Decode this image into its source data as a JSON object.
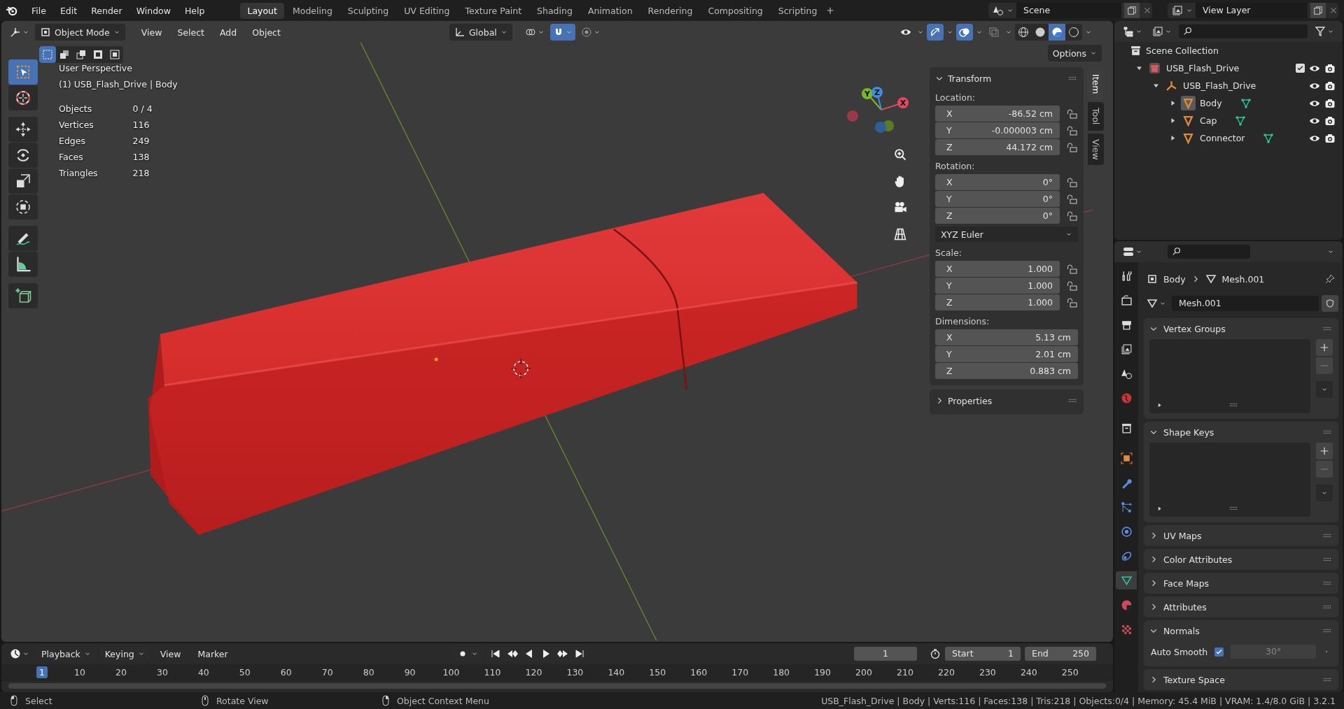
{
  "menu": [
    "File",
    "Edit",
    "Render",
    "Window",
    "Help"
  ],
  "workspaces": [
    {
      "label": "Layout",
      "selected": true
    },
    {
      "label": "Modeling",
      "selected": false
    },
    {
      "label": "Sculpting",
      "selected": false
    },
    {
      "label": "UV Editing",
      "selected": false
    },
    {
      "label": "Texture Paint",
      "selected": false
    },
    {
      "label": "Shading",
      "selected": false
    },
    {
      "label": "Animation",
      "selected": false
    },
    {
      "label": "Rendering",
      "selected": false
    },
    {
      "label": "Compositing",
      "selected": false
    },
    {
      "label": "Scripting",
      "selected": false
    }
  ],
  "scene": "Scene",
  "view_layer": "View Layer",
  "viewport": {
    "mode": "Object Mode",
    "menus": [
      "View",
      "Select",
      "Add",
      "Object"
    ],
    "orientation": "Global",
    "options": "Options",
    "select_modes": [
      {
        "selected": true
      },
      {
        "selected": false
      },
      {
        "selected": false
      },
      {
        "selected": false
      },
      {
        "selected": false
      }
    ],
    "center_toggles": [
      {
        "kind": "pivot",
        "on": false
      },
      {
        "kind": "snap",
        "on": true
      },
      {
        "kind": "proportional",
        "on": false
      }
    ],
    "right_toggles": [
      {
        "kind": "visibility",
        "on": false
      },
      {
        "kind": "gizmo",
        "on": true
      },
      {
        "kind": "overlays",
        "on": true
      },
      {
        "kind": "xray",
        "on": false
      }
    ],
    "shading": [
      {
        "kind": "wireframe",
        "selected": false
      },
      {
        "kind": "solid",
        "selected": false
      },
      {
        "kind": "material",
        "selected": true
      },
      {
        "kind": "rendered",
        "selected": false
      }
    ],
    "info": {
      "view": "User Perspective",
      "object": "(1) USB_Flash_Drive | Body",
      "stats": [
        {
          "label": "Objects",
          "value": "0 / 4"
        },
        {
          "label": "Vertices",
          "value": "116"
        },
        {
          "label": "Edges",
          "value": "249"
        },
        {
          "label": "Faces",
          "value": "138"
        },
        {
          "label": "Triangles",
          "value": "218"
        }
      ]
    },
    "tools": [
      {
        "kind": "select",
        "selected": true
      },
      {
        "kind": "cursor",
        "selected": false
      },
      {
        "kind": "move",
        "selected": false
      },
      {
        "kind": "rotate",
        "selected": false
      },
      {
        "kind": "scale",
        "selected": false
      },
      {
        "kind": "transform",
        "selected": false
      },
      {
        "kind": "annotate",
        "selected": false
      },
      {
        "kind": "measure",
        "selected": false
      },
      {
        "kind": "add-cube",
        "selected": false
      }
    ],
    "gizmo": [
      {
        "label": "X",
        "color": "#e04a5c"
      },
      {
        "label": "Y",
        "color": "#7bb728"
      },
      {
        "label": "Z",
        "color": "#3c8ee0"
      }
    ],
    "sidebar": {
      "tabs": [
        {
          "label": "Item",
          "selected": true
        },
        {
          "label": "Tool",
          "selected": false
        },
        {
          "label": "View",
          "selected": false
        }
      ],
      "transform": {
        "title": "Transform",
        "expanded": true,
        "groups": [
          {
            "label": "Location:",
            "fields": [
              {
                "axis": "X",
                "value": "-86.52 cm",
                "locked": false
              },
              {
                "axis": "Y",
                "value": "-0.000003 cm",
                "locked": false
              },
              {
                "axis": "Z",
                "value": "44.172 cm",
                "locked": false
              }
            ]
          },
          {
            "label": "Rotation:",
            "fields": [
              {
                "axis": "X",
                "value": "0°",
                "locked": false
              },
              {
                "axis": "Y",
                "value": "0°",
                "locked": false
              },
              {
                "axis": "Z",
                "value": "0°",
                "locked": false
              }
            ],
            "mode": "XYZ Euler"
          },
          {
            "label": "Scale:",
            "fields": [
              {
                "axis": "X",
                "value": "1.000",
                "locked": false
              },
              {
                "axis": "Y",
                "value": "1.000",
                "locked": false
              },
              {
                "axis": "Z",
                "value": "1.000",
                "locked": false
              }
            ]
          },
          {
            "label": "Dimensions:",
            "fields": [
              {
                "axis": "X",
                "value": "5.13 cm"
              },
              {
                "axis": "Y",
                "value": "2.01 cm"
              },
              {
                "axis": "Z",
                "value": "0.883 cm"
              }
            ]
          }
        ]
      },
      "properties": {
        "title": "Properties",
        "expanded": false
      }
    }
  },
  "outliner": {
    "root": "Scene Collection",
    "tree": [
      {
        "name": "USB_Flash_Drive",
        "kind": "collection",
        "expanded": true,
        "selected": false,
        "checked": true,
        "children": [
          {
            "name": "USB_Flash_Drive",
            "kind": "empty",
            "expanded": true,
            "selected": false,
            "children": [
              {
                "name": "Body",
                "kind": "mesh",
                "expanded": false,
                "selected": true
              },
              {
                "name": "Cap",
                "kind": "mesh",
                "expanded": false,
                "selected": false
              },
              {
                "name": "Connector",
                "kind": "mesh",
                "expanded": false,
                "selected": false
              }
            ]
          }
        ]
      }
    ]
  },
  "properties": {
    "breadcrumb": [
      "Body",
      "Mesh.001"
    ],
    "datablock": "Mesh.001",
    "tabs": [
      {
        "kind": "tool",
        "selected": false
      },
      {
        "kind": "render",
        "selected": false
      },
      {
        "kind": "output",
        "selected": false
      },
      {
        "kind": "view-layer",
        "selected": false
      },
      {
        "kind": "scene",
        "selected": false
      },
      {
        "kind": "world",
        "selected": false
      },
      {
        "kind": "collection",
        "selected": false
      },
      {
        "kind": "object",
        "selected": false
      },
      {
        "kind": "modifiers",
        "selected": false
      },
      {
        "kind": "particles",
        "selected": false
      },
      {
        "kind": "physics",
        "selected": false
      },
      {
        "kind": "constraints",
        "selected": false
      },
      {
        "kind": "data",
        "selected": true
      },
      {
        "kind": "material",
        "selected": false
      },
      {
        "kind": "texture",
        "selected": false
      }
    ],
    "panels": [
      {
        "title": "Vertex Groups",
        "kind": "list",
        "expanded": true
      },
      {
        "title": "Shape Keys",
        "kind": "list",
        "expanded": true
      },
      {
        "title": "UV Maps",
        "expanded": false
      },
      {
        "title": "Color Attributes",
        "expanded": false
      },
      {
        "title": "Face Maps",
        "expanded": false
      },
      {
        "title": "Attributes",
        "expanded": false
      },
      {
        "title": "Normals",
        "kind": "normals",
        "expanded": true,
        "option": "Auto Smooth",
        "checked": true,
        "angle": "30°"
      },
      {
        "title": "Texture Space",
        "expanded": false
      }
    ]
  },
  "timeline": {
    "menus": [
      "Playback",
      "Keying",
      "View",
      "Marker"
    ],
    "current": "1",
    "start_label": "Start",
    "start": "1",
    "end_label": "End",
    "end": "250",
    "ticks": [
      {
        "label": "1",
        "selected": true
      },
      {
        "label": "10",
        "selected": false
      },
      {
        "label": "20",
        "selected": false
      },
      {
        "label": "30",
        "selected": false
      },
      {
        "label": "40",
        "selected": false
      },
      {
        "label": "50",
        "selected": false
      },
      {
        "label": "60",
        "selected": false
      },
      {
        "label": "70",
        "selected": false
      },
      {
        "label": "80",
        "selected": false
      },
      {
        "label": "90",
        "selected": false
      },
      {
        "label": "100",
        "selected": false
      },
      {
        "label": "110",
        "selected": false
      },
      {
        "label": "120",
        "selected": false
      },
      {
        "label": "130",
        "selected": false
      },
      {
        "label": "140",
        "selected": false
      },
      {
        "label": "150",
        "selected": false
      },
      {
        "label": "160",
        "selected": false
      },
      {
        "label": "170",
        "selected": false
      },
      {
        "label": "180",
        "selected": false
      },
      {
        "label": "190",
        "selected": false
      },
      {
        "label": "200",
        "selected": false
      },
      {
        "label": "210",
        "selected": false
      },
      {
        "label": "220",
        "selected": false
      },
      {
        "label": "230",
        "selected": false
      },
      {
        "label": "240",
        "selected": false
      },
      {
        "label": "250",
        "selected": false
      }
    ]
  },
  "status": {
    "hints": [
      {
        "kind": "left",
        "label": "Select"
      },
      {
        "kind": "middle",
        "label": "Rotate View"
      },
      {
        "kind": "right",
        "label": "Object Context Menu"
      }
    ],
    "info": "USB_Flash_Drive | Body | Verts:116 | Faces:138 | Tris:218 | Objects:0/4 | Memory: 45.4 MiB | VRAM: 1.4/8.0 GiB | 3.2.1"
  }
}
